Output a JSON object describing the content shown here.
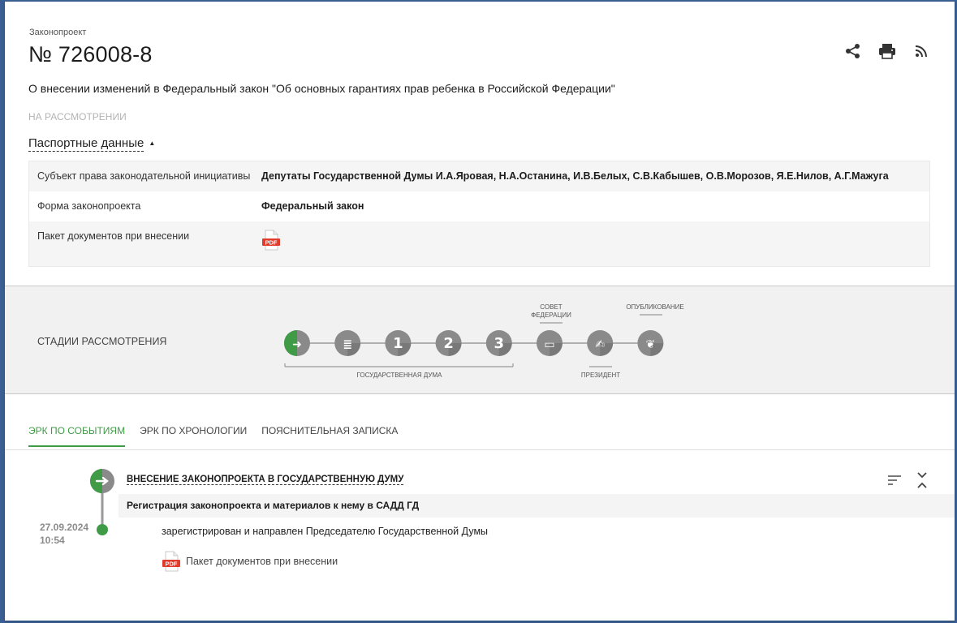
{
  "header": {
    "kicker": "Законопроект",
    "title": "№ 726008-8",
    "description": "О внесении изменений в Федеральный закон \"Об основных гарантиях прав ребенка в Российской Федерации\"",
    "status": "НА РАССМОТРЕНИИ",
    "icons": [
      "share-icon",
      "print-icon",
      "rss-icon"
    ]
  },
  "passport": {
    "toggle_label": "Паспортные данные",
    "rows": [
      {
        "key": "Субъект права законодательной инициативы",
        "value": "Депутаты Государственной Думы И.А.Яровая, Н.А.Останина, И.В.Белых, С.В.Кабышев, О.В.Морозов, Я.Е.Нилов, А.Г.Мажуга"
      },
      {
        "key": "Форма законопроекта",
        "value": "Федеральный закон"
      },
      {
        "key": "Пакет документов при внесении",
        "value": ""
      }
    ],
    "pdf_label": "PDF"
  },
  "stages": {
    "label": "СТАДИИ РАССМОТРЕНИЯ",
    "steps": [
      {
        "glyph": "➜",
        "status": "active"
      },
      {
        "glyph": "≣",
        "status": "pending"
      },
      {
        "glyph": "1",
        "status": "pending"
      },
      {
        "glyph": "2",
        "status": "pending"
      },
      {
        "glyph": "3",
        "status": "pending"
      },
      {
        "glyph": "▭",
        "status": "pending"
      },
      {
        "glyph": "✍",
        "status": "pending"
      },
      {
        "glyph": "❦",
        "status": "pending"
      }
    ],
    "group_duma": "ГОСУДАРСТВЕННАЯ ДУМА",
    "group_council_line1": "СОВЕТ",
    "group_council_line2": "ФЕДЕРАЦИИ",
    "group_president": "ПРЕЗИДЕНТ",
    "group_publication": "ОПУБЛИКОВАНИЕ",
    "colors": {
      "active": "#3f9b46",
      "pending": "#8a8a8a",
      "line": "#8a8a8a"
    }
  },
  "tabs": [
    {
      "label": "ЭРК ПО СОБЫТИЯМ",
      "active": true
    },
    {
      "label": "ЭРК ПО ХРОНОЛОГИИ",
      "active": false
    },
    {
      "label": "ПОЯСНИТЕЛЬНАЯ ЗАПИСКА",
      "active": false
    }
  ],
  "timeline": {
    "event_title": "ВНЕСЕНИЕ ЗАКОНОПРОЕКТА В ГОСУДАРСТВЕННУЮ ДУМУ",
    "sub_title": "Регистрация законопроекта и материалов к нему в САДД ГД",
    "date": "27.09.2024",
    "time": "10:54",
    "text": "зарегистрирован и направлен Председателю Государственной Думы",
    "doc_label": "Пакет документов при внесении",
    "icons": [
      "sort-icon",
      "collapse-icon"
    ]
  }
}
